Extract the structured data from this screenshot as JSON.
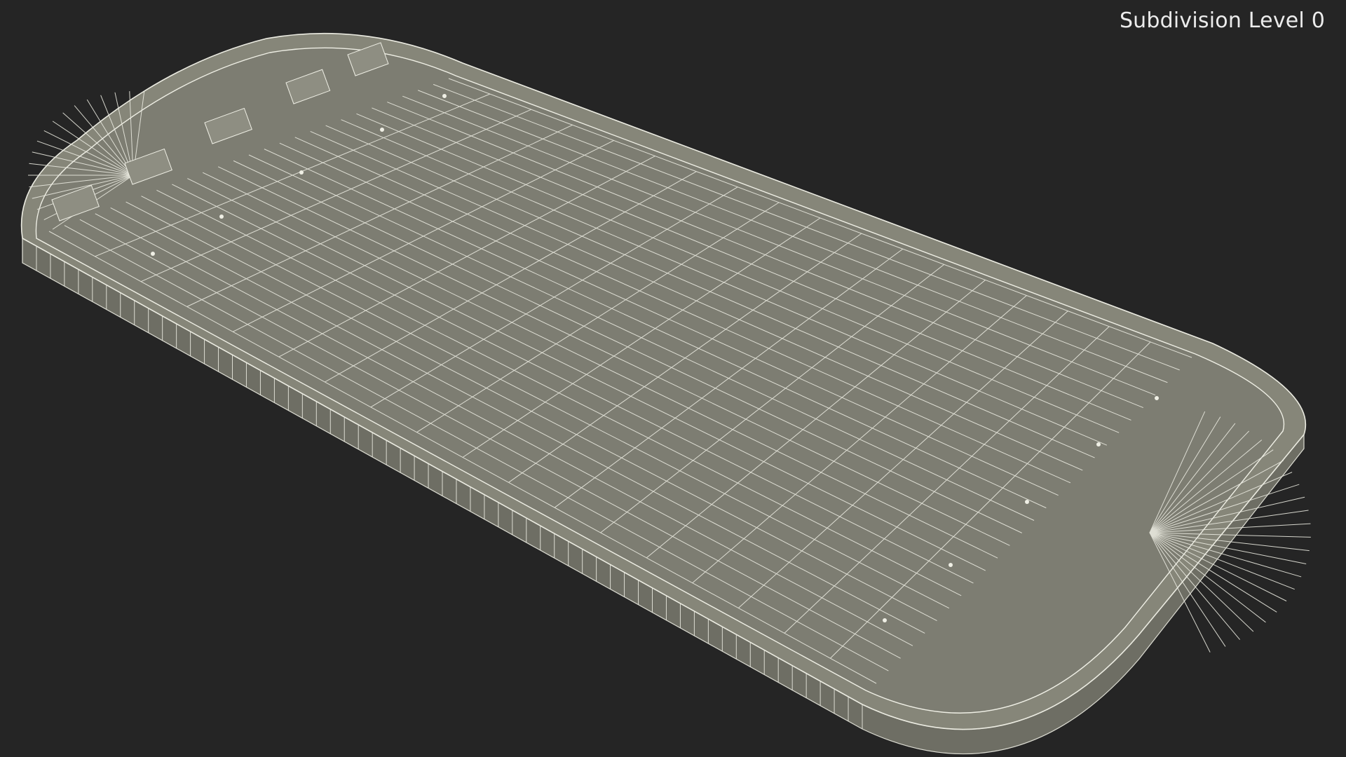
{
  "overlay": {
    "label": "Subdivision Level 0"
  },
  "scene": {
    "background_color": "#252525",
    "surface_color": "#7d7d72",
    "wire_color": "#e6e6dc",
    "object": "ice-rink-wireframe"
  }
}
